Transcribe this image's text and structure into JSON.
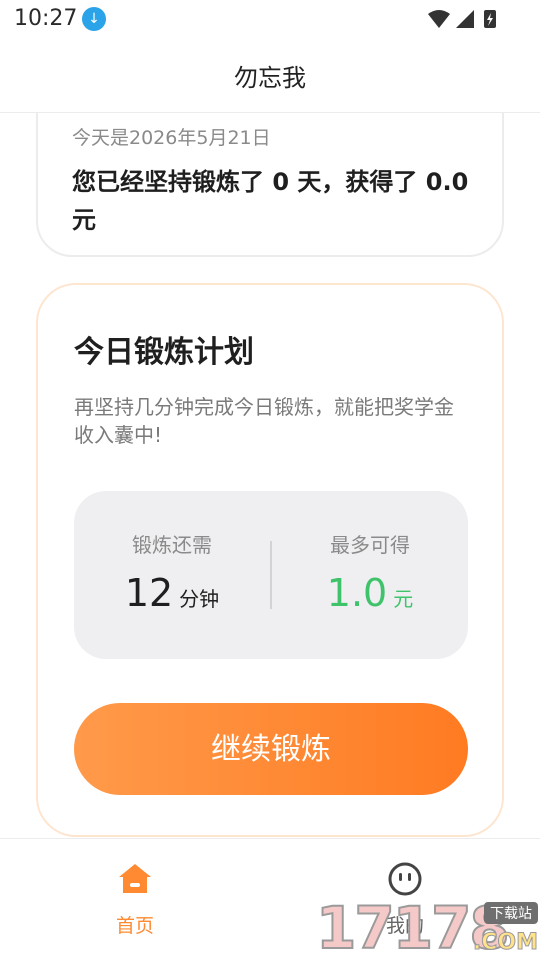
{
  "status_bar": {
    "time": "10:27",
    "download_icon": "download-icon"
  },
  "app_bar": {
    "title": "勿忘我"
  },
  "summary_card": {
    "date_text": "今天是2026年5月21日",
    "streak_text": "您已经坚持锻炼了 0 天，获得了 0.0 元"
  },
  "plan_card": {
    "title": "今日锻炼计划",
    "description": "再坚持几分钟完成今日锻炼，就能把奖学金收入囊中!",
    "remaining": {
      "label": "锻炼还需",
      "value": "12",
      "unit": "分钟"
    },
    "reward": {
      "label": "最多可得",
      "value": "1.0",
      "unit": "元"
    },
    "button_label": "继续锻炼"
  },
  "bottom_nav": {
    "items": [
      {
        "label": "首页",
        "icon": "home-icon",
        "active": true
      },
      {
        "label": "我的",
        "icon": "face-icon",
        "active": false
      }
    ]
  },
  "watermark": {
    "number": "17178",
    "badge": "下载站",
    "suffix": ".COM"
  },
  "colors": {
    "accent": "#ff8a32",
    "reward_green": "#3ec36b",
    "card_border": "#fde5cf"
  }
}
